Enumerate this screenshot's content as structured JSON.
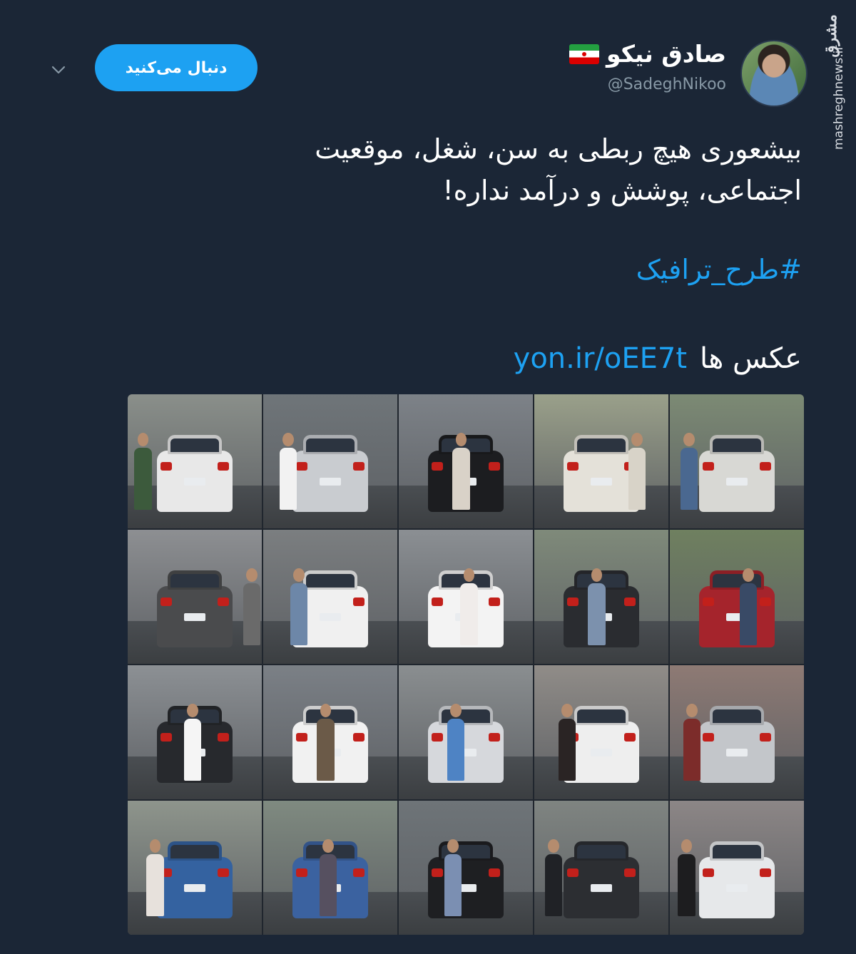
{
  "watermark": {
    "logo": "مشرق",
    "url": "mashreghnews.ir"
  },
  "user": {
    "name": "صادق نیکو",
    "handle": "@SadeghNikoo",
    "flag": "iran-flag"
  },
  "header": {
    "follow_label": "دنبال می‌کنید",
    "menu_icon": "chevron-down-icon"
  },
  "tweet": {
    "text_line1": "بیشعوری هیچ ربطی به سن، شغل، موقعیت",
    "text_line2": "اجتماعی، پوشش و درآمد نداره!",
    "hashtag": "#طرح_ترافیک",
    "photos_label": "عکس ها",
    "photos_link": "yon.ir/oEE7t"
  },
  "colors": {
    "background": "#1b2636",
    "accent": "#1da1f2",
    "muted": "#8899a6"
  },
  "photo_grid": {
    "rows": 4,
    "columns": 5,
    "cells": [
      {
        "car": "#e8e8e8",
        "bg": "#8a8f8a",
        "person": "#3c5a3c",
        "px": "5%"
      },
      {
        "car": "#c9ccd0",
        "bg": "#6f7579",
        "person": "#f2f2f2",
        "px": "12%"
      },
      {
        "car": "#1c1d20",
        "bg": "#7d8288",
        "person": "#d9d2c8",
        "px": "40%"
      },
      {
        "car": "#e4e1d9",
        "bg": "#9aa08a",
        "person": "#d8d3c8",
        "px": "70%"
      },
      {
        "car": "#d8d8d4",
        "bg": "#7c8a74",
        "person": "#4a6890",
        "px": "8%"
      },
      {
        "car": "#4a4b4d",
        "bg": "#8d8f92",
        "person": "#6a6a6a",
        "px": "86%"
      },
      {
        "car": "#f0f0f0",
        "bg": "#7b7e80",
        "person": "#6d87a8",
        "px": "20%"
      },
      {
        "car": "#f3f3f3",
        "bg": "#8b8f93",
        "person": "#f0ecea",
        "px": "46%"
      },
      {
        "car": "#2a2c30",
        "bg": "#7f8a7a",
        "person": "#7c91ad",
        "px": "40%"
      },
      {
        "car": "#a5242c",
        "bg": "#6f8060",
        "person": "#394a66",
        "px": "52%"
      },
      {
        "car": "#27292d",
        "bg": "#8c9094",
        "person": "#f5f5f5",
        "px": "42%"
      },
      {
        "car": "#f1f1f1",
        "bg": "#7b8086",
        "person": "#6b5a48",
        "px": "40%"
      },
      {
        "car": "#d6d8dc",
        "bg": "#8a8e90",
        "person": "#4e83c4",
        "px": "36%"
      },
      {
        "car": "#eeeeee",
        "bg": "#908c88",
        "person": "#2a2424",
        "px": "18%"
      },
      {
        "car": "#c3c6ca",
        "bg": "#8e7a74",
        "person": "#7c2c2a",
        "px": "10%"
      },
      {
        "car": "#3462a0",
        "bg": "#8e958c",
        "person": "#e7e1dc",
        "px": "14%"
      },
      {
        "car": "#3b62a0",
        "bg": "#7f8a80",
        "person": "#565060",
        "px": "42%"
      },
      {
        "car": "#1e1f22",
        "bg": "#6e7478",
        "person": "#7b8fb2",
        "px": "34%"
      },
      {
        "car": "#2c2e32",
        "bg": "#7f8481",
        "person": "#202226",
        "px": "8%"
      },
      {
        "car": "#e6e8ea",
        "bg": "#8c8686",
        "person": "#1d1d1f",
        "px": "6%"
      }
    ]
  }
}
